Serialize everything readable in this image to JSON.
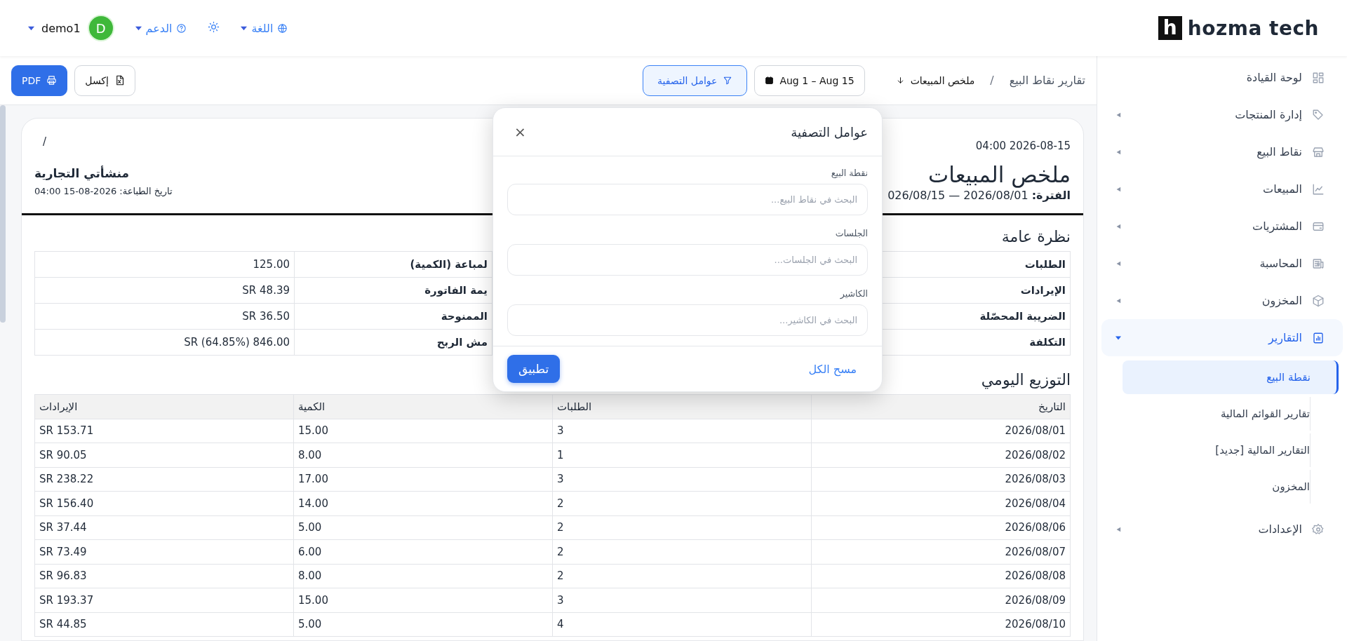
{
  "header": {
    "logo": {
      "mark": "h",
      "name": "hozma tech"
    },
    "language": "اللغة",
    "support": "الدعم",
    "user": {
      "initial": "D",
      "name": "demo1"
    }
  },
  "sidebar": {
    "items": [
      {
        "kind": "link",
        "label": "لوحة القيادة",
        "selected": false
      },
      {
        "kind": "group",
        "label": "إدارة المنتجات",
        "expanded": false,
        "selected": false
      },
      {
        "kind": "group",
        "label": "نقاط البيع",
        "expanded": false,
        "selected": false
      },
      {
        "kind": "group",
        "label": "المبيعات",
        "expanded": false,
        "selected": false
      },
      {
        "kind": "group",
        "label": "المشتريات",
        "expanded": false,
        "selected": false
      },
      {
        "kind": "group",
        "label": "المحاسبة",
        "expanded": false,
        "selected": false
      },
      {
        "kind": "group",
        "label": "المخزون",
        "expanded": false,
        "selected": false
      },
      {
        "kind": "group",
        "label": "التقارير",
        "expanded": true,
        "selected": true,
        "children": [
          {
            "label": "نقطة البيع",
            "selected": true
          },
          {
            "label": "تقارير القوائم المالية",
            "selected": false
          },
          {
            "label": "التقارير المالية [جديد]",
            "selected": false
          },
          {
            "label": "المخزون",
            "selected": false
          }
        ]
      },
      {
        "kind": "group",
        "label": "الإعدادات",
        "expanded": false,
        "selected": false
      }
    ]
  },
  "toolbar": {
    "breadcrumb": [
      "تقارير نقاط البيع",
      "ملخص المبيعات"
    ],
    "separator": "/",
    "date_range": "Aug 1 – Aug 15",
    "filter": {
      "label": "عوامل التصفية",
      "active": true
    },
    "exports": [
      {
        "label": "إكسل",
        "kind": "secondary"
      },
      {
        "label": "PDF",
        "kind": "primary"
      }
    ]
  },
  "report": {
    "timestamp": "2026-08-15 04:00",
    "marker": "/",
    "title": "ملخص المبيعات",
    "period": "**الفترة:** 2026/08/01 — 026/08/15",
    "company": "منشأتي التجارية",
    "print_date": "تاريخ الطباعة: 2026-08-15 04:00",
    "overview": {
      "title": "نظرة عامة",
      "rows": [
        {
          "label": "الطلبات",
          "label_2": "لمباعة (الكمية)",
          "value_2": "125.00"
        },
        {
          "label": "الإيرادات",
          "label_2": "يمة الفاتورة",
          "value_2": "SR 48.39"
        },
        {
          "label": "الضريبة المحصّلة",
          "label_2": "الممنوحة",
          "value_2": "SR 36.50"
        },
        {
          "label": "التكلفة",
          "label_2": "مش الربح",
          "value_2": "SR (64.85%) 846.00"
        }
      ]
    },
    "daily": {
      "title": "التوزيع اليومي",
      "columns": [
        "التاريخ",
        "الطلبات",
        "الكمية",
        "الإيرادات"
      ],
      "rows": [
        [
          "2026/08/01",
          "3",
          "15.00",
          "SR 153.71"
        ],
        [
          "2026/08/02",
          "1",
          "8.00",
          "SR 90.05"
        ],
        [
          "2026/08/03",
          "3",
          "17.00",
          "SR 238.22"
        ],
        [
          "2026/08/04",
          "2",
          "14.00",
          "SR 156.40"
        ],
        [
          "2026/08/06",
          "2",
          "5.00",
          "SR 37.44"
        ],
        [
          "2026/08/07",
          "2",
          "6.00",
          "SR 73.49"
        ],
        [
          "2026/08/08",
          "2",
          "8.00",
          "SR 96.83"
        ],
        [
          "2026/08/09",
          "3",
          "15.00",
          "SR 193.37"
        ],
        [
          "2026/08/10",
          "4",
          "5.00",
          "SR 44.85"
        ]
      ]
    }
  },
  "filter_panel": {
    "title": "عوامل التصفية",
    "close": "×",
    "fields": [
      {
        "label": "نقطة البيع",
        "placeholder": "البحث في نقاط البيع..."
      },
      {
        "label": "الجلسات",
        "placeholder": "البحث في الجلسات..."
      },
      {
        "label": "الكاشير",
        "placeholder": "البحث في الكاشير..."
      }
    ],
    "clear": "مسح الكل",
    "apply": "تطبيق"
  }
}
